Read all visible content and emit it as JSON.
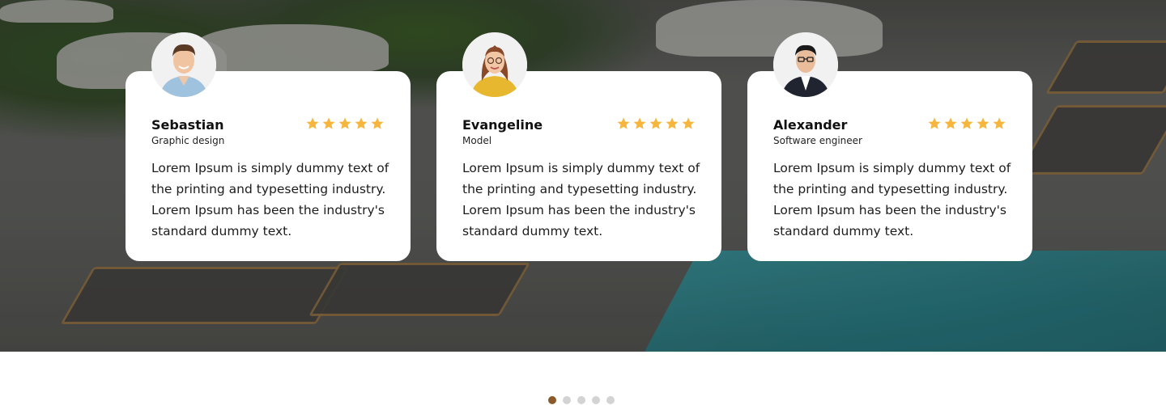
{
  "testimonials": [
    {
      "name": "Sebastian",
      "role": "Graphic design",
      "rating": 5,
      "text": "Lorem Ipsum is simply dummy text of the printing and typesetting industry. Lorem Ipsum has been the industry's standard dummy text."
    },
    {
      "name": "Evangeline",
      "role": "Model",
      "rating": 5,
      "text": "Lorem Ipsum is simply dummy text of the printing and typesetting industry. Lorem Ipsum has been the industry's standard dummy text."
    },
    {
      "name": "Alexander",
      "role": "Software engineer",
      "rating": 5,
      "text": "Lorem Ipsum is simply dummy text of the printing and typesetting industry. Lorem Ipsum has been the industry's standard dummy text."
    }
  ],
  "pagination": {
    "count": 5,
    "active_index": 0
  },
  "colors": {
    "star": "#F6B53D",
    "dot_active": "#8B5A2B",
    "dot_inactive": "#D3D3D3",
    "card_bg": "#FFFFFF"
  },
  "icons": {
    "rating": "star-icon",
    "avatar": "avatar"
  }
}
